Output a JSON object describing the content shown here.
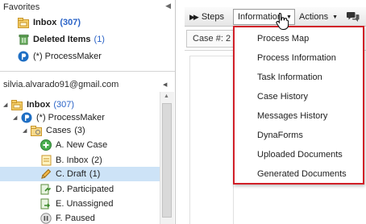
{
  "favorites": {
    "title": "Favorites",
    "items": [
      {
        "label": "Inbox",
        "count": "(307)",
        "icon": "inbox-folder-icon"
      },
      {
        "label": "Deleted Items",
        "count": "(1)",
        "icon": "deleted-items-icon"
      },
      {
        "label": "(*) ProcessMaker",
        "count": "",
        "icon": "processmaker-icon"
      }
    ]
  },
  "account": {
    "email": "silvia.alvarado91@gmail.com",
    "inbox": {
      "label": "Inbox",
      "count": "(307)"
    },
    "processmaker": "(*) ProcessMaker",
    "cases": {
      "label": "Cases",
      "count": "(3)"
    },
    "case_items": [
      {
        "label": "A. New Case",
        "count": "",
        "icon": "add-case-icon"
      },
      {
        "label": "B. Inbox",
        "count": "(2)",
        "icon": "inbox-case-icon"
      },
      {
        "label": "C. Draft",
        "count": "(1)",
        "icon": "draft-pencil-icon"
      },
      {
        "label": "D. Participated",
        "count": "",
        "icon": "participated-icon"
      },
      {
        "label": "E. Unassigned",
        "count": "",
        "icon": "unassigned-icon"
      },
      {
        "label": "F. Paused",
        "count": "",
        "icon": "paused-icon"
      }
    ]
  },
  "toolbar": {
    "steps_label": "Steps",
    "information_label": "Information",
    "actions_label": "Actions"
  },
  "case_tab": {
    "label": "Case #: 2"
  },
  "information_menu": [
    "Process Map",
    "Process Information",
    "Task Information",
    "Case History",
    "Messages History",
    "DynaForms",
    "Uploaded Documents",
    "Generated Documents"
  ],
  "colors": {
    "accent_blue": "#2a63c7",
    "highlight_border": "#d11f28",
    "selection": "#cde3f7"
  }
}
